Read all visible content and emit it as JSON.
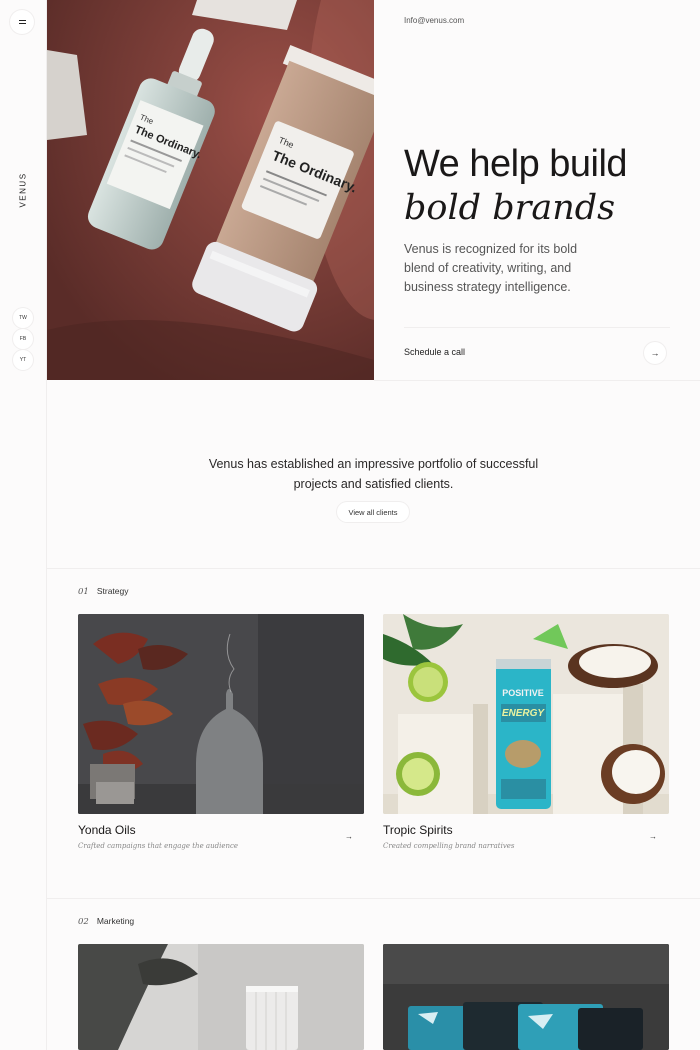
{
  "brand": "VENUS",
  "contact": {
    "email": "Info@venus.com"
  },
  "social": [
    "TW",
    "FB",
    "YT"
  ],
  "hero": {
    "headline_line1": "We help build",
    "headline_line2": "bold brands",
    "description": "Venus is recognized for its bold blend of creativity, writing, and business strategy intelligence.",
    "cta_label": "Schedule a call",
    "product_left_brand": "The Ordinary.",
    "product_right_brand": "The Ordinary."
  },
  "intro": {
    "text": "Venus has established an impressive portfolio of successful projects and satisfied clients.",
    "button_label": "View all clients"
  },
  "sections": [
    {
      "number": "01",
      "title": "Strategy",
      "cards": [
        {
          "title": "Yonda Oils",
          "subtitle": "Crafted campaigns that engage the audience"
        },
        {
          "title": "Tropic Spirits",
          "subtitle": "Created compelling brand narratives"
        }
      ]
    },
    {
      "number": "02",
      "title": "Marketing"
    }
  ],
  "icons": {
    "menu": "menu-icon",
    "arrow": "arrow-right-icon"
  },
  "colors": {
    "hero_bg": "#6f3a35",
    "accent_teal": "#2bb5c8",
    "page_bg": "#fcfbfb"
  }
}
